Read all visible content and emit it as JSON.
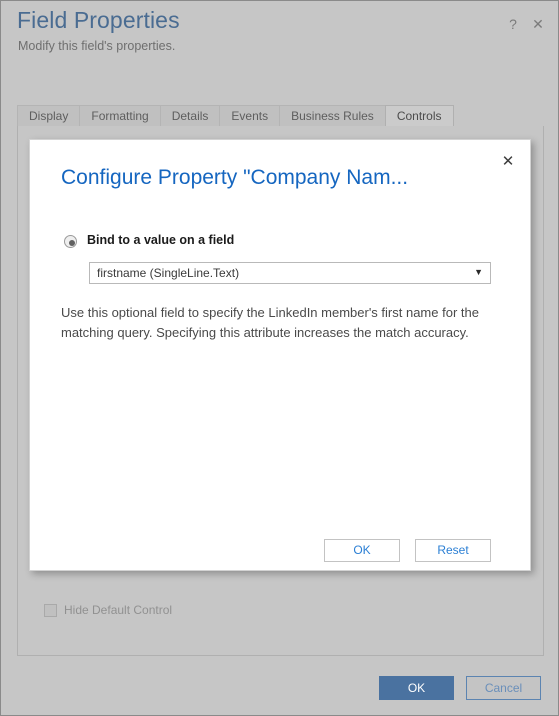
{
  "header": {
    "title": "Field Properties",
    "subtitle": "Modify this field's properties.",
    "help_icon": "?",
    "close_icon": "✕"
  },
  "tabs": [
    {
      "label": "Display",
      "active": false
    },
    {
      "label": "Formatting",
      "active": false
    },
    {
      "label": "Details",
      "active": false
    },
    {
      "label": "Events",
      "active": false
    },
    {
      "label": "Business Rules",
      "active": false
    },
    {
      "label": "Controls",
      "active": true
    }
  ],
  "content": {
    "hide_default_control_label": "Hide Default Control",
    "hide_default_control_checked": false
  },
  "footer": {
    "ok_label": "OK",
    "cancel_label": "Cancel"
  },
  "modal": {
    "title": "Configure Property \"Company Nam...",
    "close_icon": "✕",
    "radio_label": "Bind to a value on a field",
    "radio_selected": true,
    "select_value": "firstname (SingleLine.Text)",
    "select_arrow": "▼",
    "description": "Use this optional field to specify the LinkedIn member's first name for the matching query. Specifying this attribute increases the match accuracy.",
    "ok_label": "OK",
    "reset_label": "Reset"
  },
  "colors": {
    "accent_blue": "#1566c0",
    "link_blue": "#2b7fd4",
    "primary_button": "#4a72a0",
    "title_blue": "#4a6c92",
    "window_bg": "#c6c6c6"
  }
}
